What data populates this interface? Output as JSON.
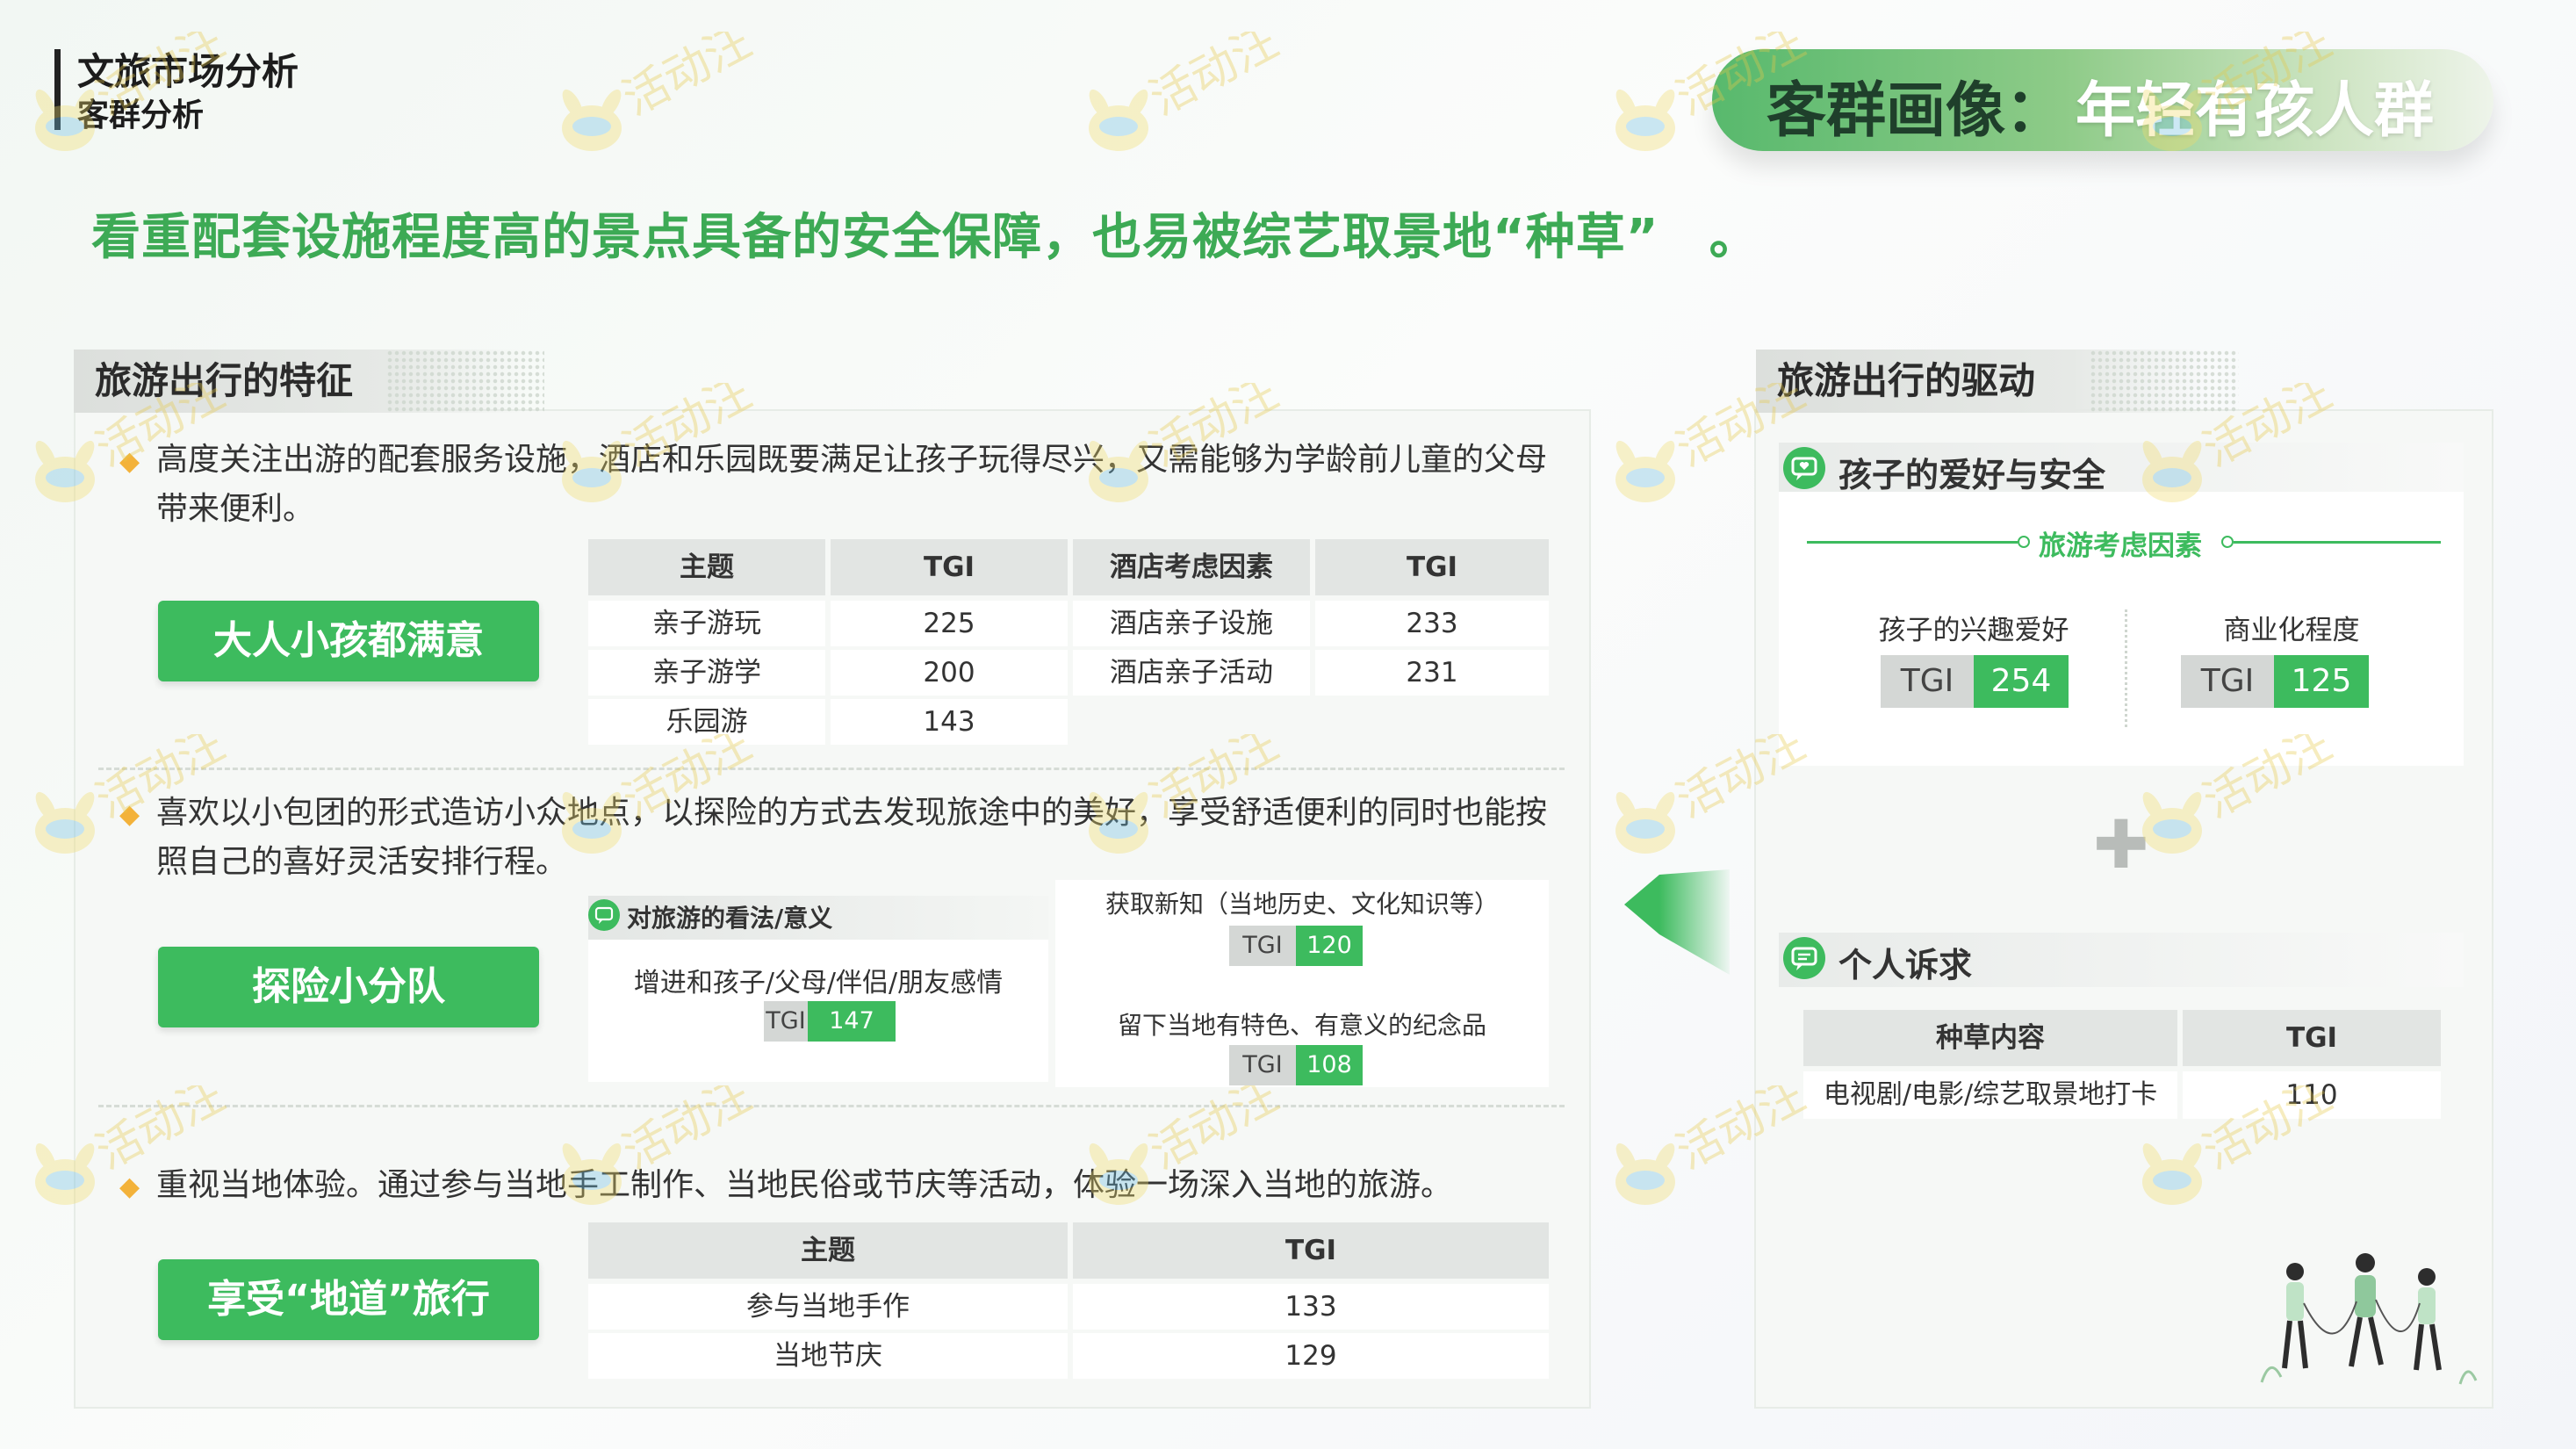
{
  "header": {
    "title": "文旅市场分析",
    "subtitle": "客群分析",
    "banner_label": "客群画像：",
    "banner_value": "年轻有孩人群"
  },
  "headline": "看重配套设施程度高的景点具备的安全保障，也易被综艺取景地“种草”　。",
  "watermark": "活动汪",
  "left_panel": {
    "title": "旅游出行的特征",
    "section1": {
      "text": "高度关注出游的配套服务设施，酒店和乐园既要满足让孩子玩得尽兴，又需能够为学龄前儿童的父母带来便利。",
      "button": "大人小孩都满意",
      "table1": {
        "headers": [
          "主题",
          "TGI"
        ],
        "rows": [
          [
            "亲子游玩",
            "225"
          ],
          [
            "亲子游学",
            "200"
          ],
          [
            "乐园游",
            "143"
          ]
        ]
      },
      "table2": {
        "headers": [
          "酒店考虑因素",
          "TGI"
        ],
        "rows": [
          [
            "酒店亲子设施",
            "233"
          ],
          [
            "酒店亲子活动",
            "231"
          ]
        ]
      }
    },
    "section2": {
      "text": "喜欢以小包团的形式造访小众地点，以探险的方式去发现旅途中的美好，享受舒适便利的同时也能按照自己的喜好灵活安排行程。",
      "button": "探险小分队",
      "card_title": "对旅游的看法/意义",
      "items": [
        {
          "label": "增进和孩子/父母/伴侣/朋友感情",
          "tgi_label": "TGI",
          "tgi": "147"
        },
        {
          "label": "获取新知（当地历史、文化知识等）",
          "tgi_label": "TGI",
          "tgi": "120"
        },
        {
          "label": "留下当地有特色、有意义的纪念品",
          "tgi_label": "TGI",
          "tgi": "108"
        }
      ]
    },
    "section3": {
      "text": "重视当地体验。通过参与当地手工制作、当地民俗或节庆等活动，体验一场深入当地的旅游。",
      "button": "享受“地道”旅行",
      "table": {
        "headers": [
          "主题",
          "TGI"
        ],
        "rows": [
          [
            "参与当地手作",
            "133"
          ],
          [
            "当地节庆",
            "129"
          ]
        ]
      }
    }
  },
  "right_panel": {
    "title": "旅游出行的驱动",
    "card1": {
      "title": "孩子的爱好与安全",
      "subtitle": "旅游考虑因素",
      "items": [
        {
          "label": "孩子的兴趣爱好",
          "tgi_label": "TGI",
          "tgi": "254"
        },
        {
          "label": "商业化程度",
          "tgi_label": "TGI",
          "tgi": "125"
        }
      ]
    },
    "plus": "✚",
    "card2": {
      "title": "个人诉求",
      "table": {
        "headers": [
          "种草内容",
          "TGI"
        ],
        "rows": [
          [
            "电视剧/电影/综艺取景地打卡",
            "110"
          ]
        ]
      }
    }
  },
  "colors": {
    "accent_green": "#3dbb5e",
    "headline_green": "#3daa55",
    "bullet_orange": "#f3b23a",
    "table_header_gray": "#e2e5e3"
  },
  "icons": [
    "chat-heart-icon",
    "chat-bubble-icon",
    "plus-icon",
    "arrow-left-icon",
    "family-illustration-icon",
    "bullet-icon"
  ]
}
